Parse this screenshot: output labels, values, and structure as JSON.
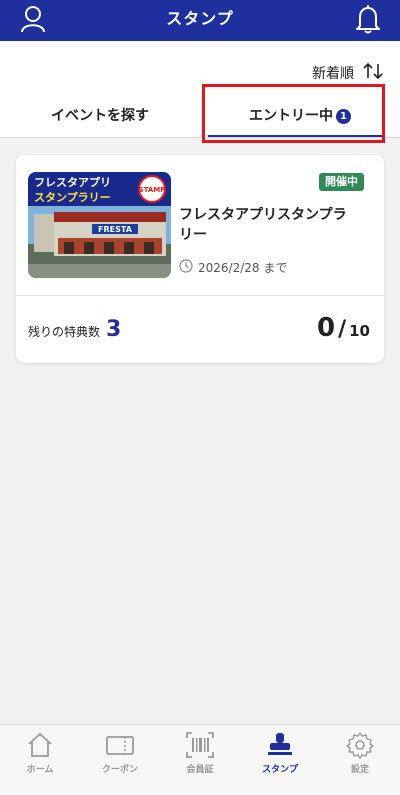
{
  "header": {
    "title": "スタンプ",
    "user_icon": "user-icon",
    "bell_icon": "bell-icon"
  },
  "sort": {
    "label": "新着順",
    "icon": "sort-arrows-icon"
  },
  "tabs": [
    {
      "label": "イベントを探す",
      "active": false
    },
    {
      "label": "エントリー中",
      "badge": "1",
      "active": true
    }
  ],
  "event_card": {
    "image_text": {
      "line1": "フレスタアプリ",
      "line2": "スタンプラリー",
      "stamp": "STAMP",
      "store_sign": "FRESTA"
    },
    "status": "開催中",
    "title": "フレスタアプリスタンプラリー",
    "date": "2026/2/28 まで",
    "remaining_label": "残りの特典数",
    "remaining_value": "3",
    "stamp_count": "0",
    "stamp_total": "10"
  },
  "bottom_nav": [
    {
      "label": "ホーム",
      "icon": "home-icon"
    },
    {
      "label": "クーポン",
      "icon": "coupon-icon"
    },
    {
      "label": "会員証",
      "icon": "barcode-icon"
    },
    {
      "label": "スタンプ",
      "icon": "stamp-icon",
      "active": true
    },
    {
      "label": "設定",
      "icon": "gear-icon"
    }
  ],
  "colors": {
    "brand": "#1f2f9e",
    "status_green": "#2f8a57",
    "highlight_red": "#e5161b"
  }
}
